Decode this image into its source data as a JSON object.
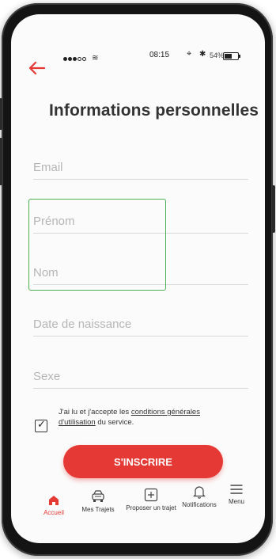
{
  "status_bar": {
    "time": "08:15",
    "battery_percent": "54%"
  },
  "page": {
    "title": "Informations personnelles"
  },
  "form": {
    "email_placeholder": "Email",
    "first_name_placeholder": "Prénom",
    "last_name_placeholder": "Nom",
    "birthdate_placeholder": "Date de naissance",
    "gender_placeholder": "Sexe"
  },
  "terms": {
    "prefix": "J'ai lu et j'accepte les ",
    "link_1": "conditions générales",
    "link_2": "d'utilisation",
    "suffix": " du service.",
    "checked": true
  },
  "submit_label": "S'INSCRIRE",
  "tabbar": {
    "items": [
      {
        "label": "Accueil",
        "icon": "home-icon",
        "active": true
      },
      {
        "label": "Mes Trajets",
        "icon": "car-icon",
        "active": false
      },
      {
        "label": "Proposer un trajet",
        "icon": "plus-square-icon",
        "active": false
      },
      {
        "label": "Notifications",
        "icon": "bell-icon",
        "active": false
      },
      {
        "label": "Menu",
        "icon": "menu-icon",
        "active": false
      }
    ]
  },
  "colors": {
    "accent": "#e53935",
    "focus": "#4caf50"
  }
}
